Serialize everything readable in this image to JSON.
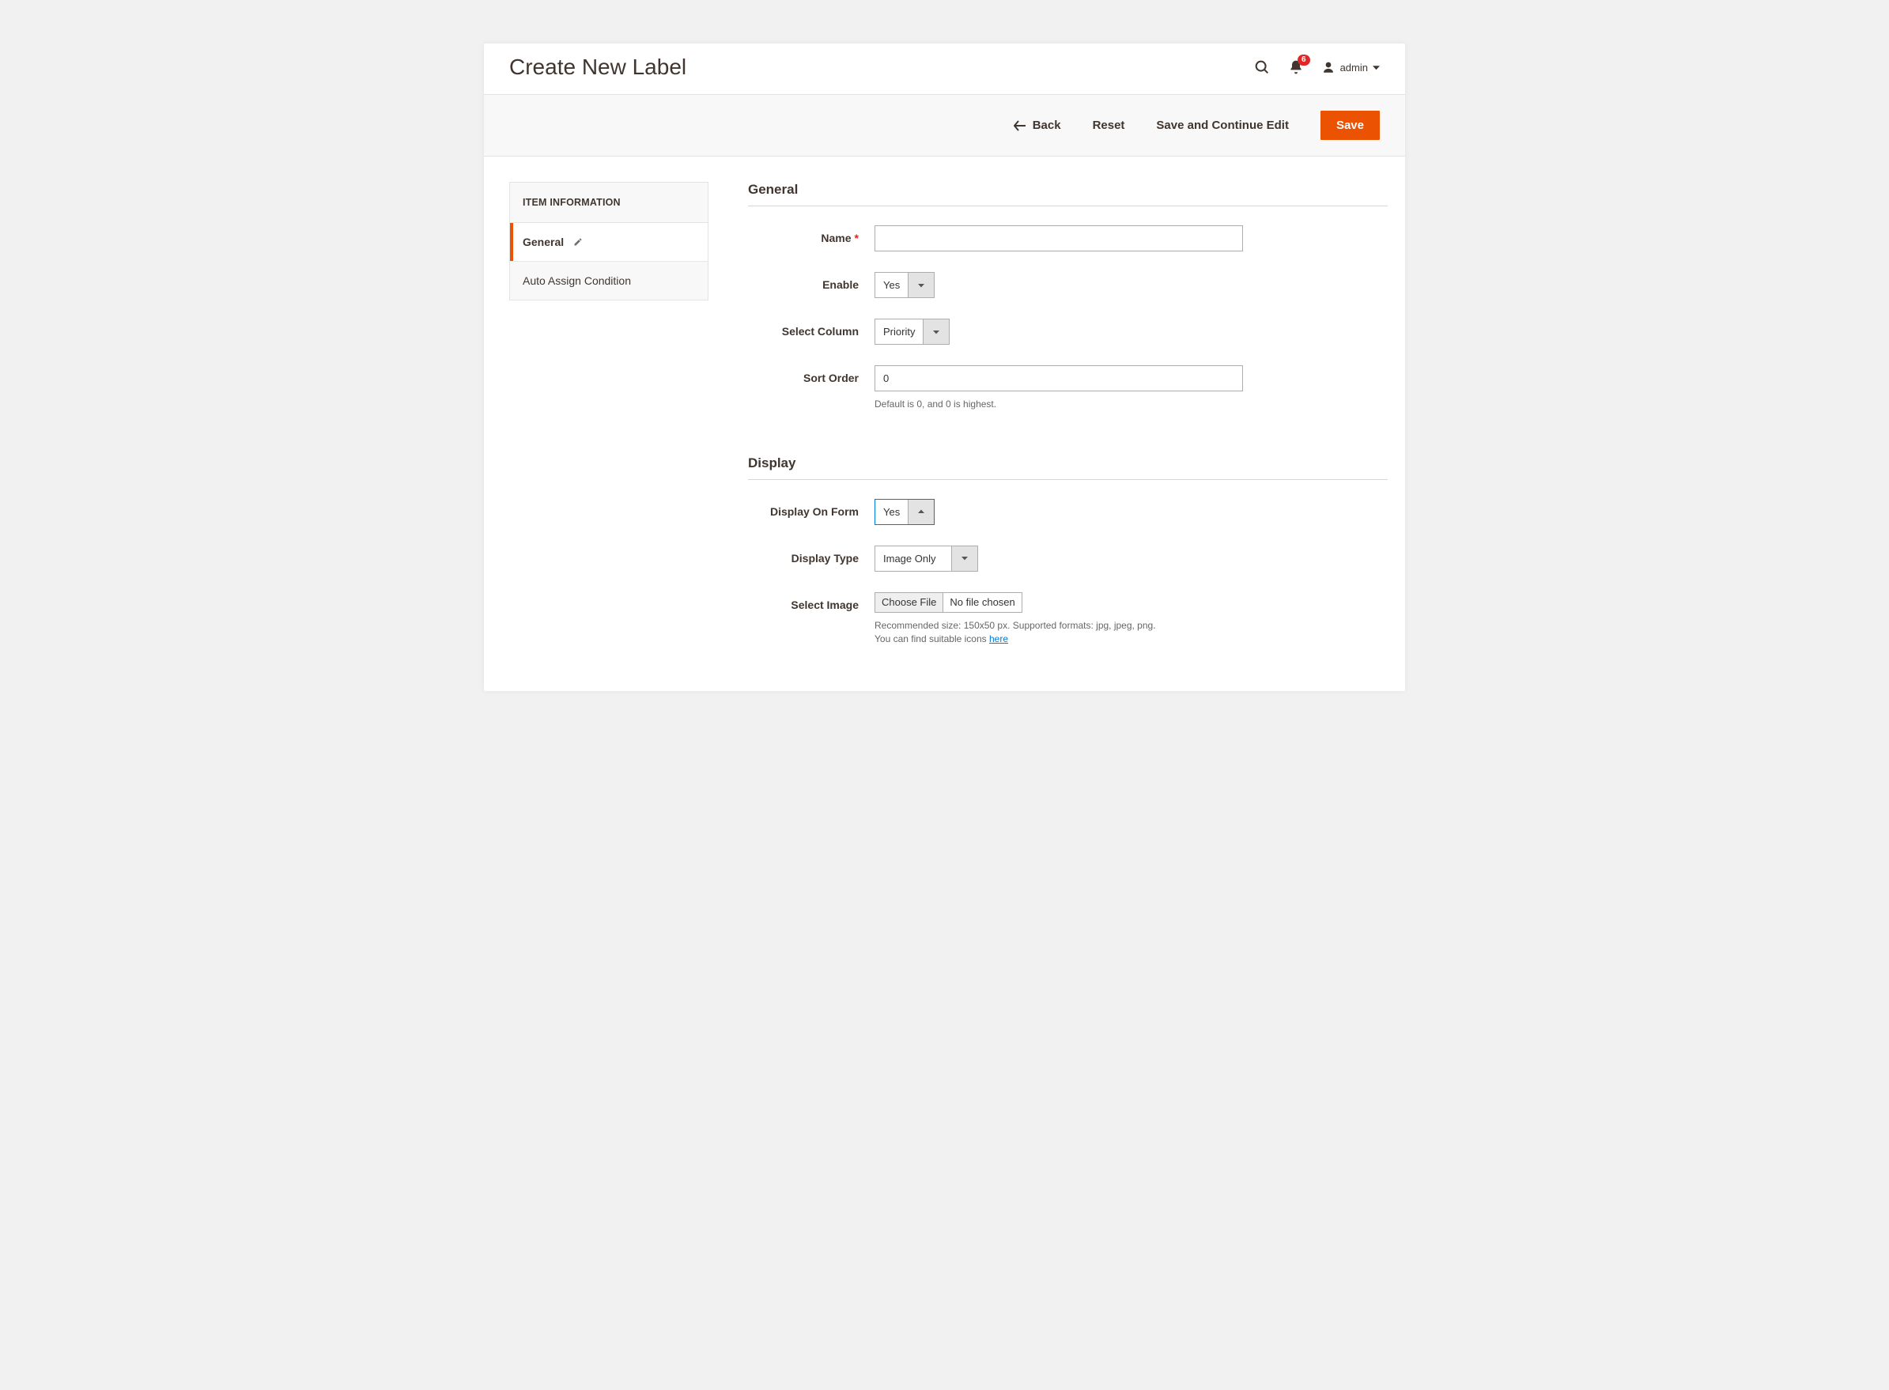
{
  "header": {
    "title": "Create New Label",
    "notification_count": "6",
    "user_label": "admin"
  },
  "actions": {
    "back": "Back",
    "reset": "Reset",
    "save_continue": "Save and Continue Edit",
    "save": "Save"
  },
  "sidebar": {
    "title": "ITEM INFORMATION",
    "items": [
      {
        "label": "General",
        "active": true
      },
      {
        "label": "Auto Assign Condition",
        "active": false
      }
    ]
  },
  "sections": {
    "general": {
      "title": "General",
      "name_label": "Name",
      "name_value": "",
      "enable_label": "Enable",
      "enable_value": "Yes",
      "select_column_label": "Select Column",
      "select_column_value": "Priority",
      "sort_order_label": "Sort Order",
      "sort_order_value": "0",
      "sort_order_help": "Default is 0, and 0 is highest."
    },
    "display": {
      "title": "Display",
      "display_on_form_label": "Display On Form",
      "display_on_form_value": "Yes",
      "display_type_label": "Display Type",
      "display_type_value": "Image Only",
      "select_image_label": "Select Image",
      "choose_file_btn": "Choose File",
      "no_file_text": "No file chosen",
      "image_help_1": "Recommended size: 150x50 px. Supported formats: jpg, jpeg, png.",
      "image_help_2a": "You can find suitable icons ",
      "image_help_link": "here"
    }
  }
}
